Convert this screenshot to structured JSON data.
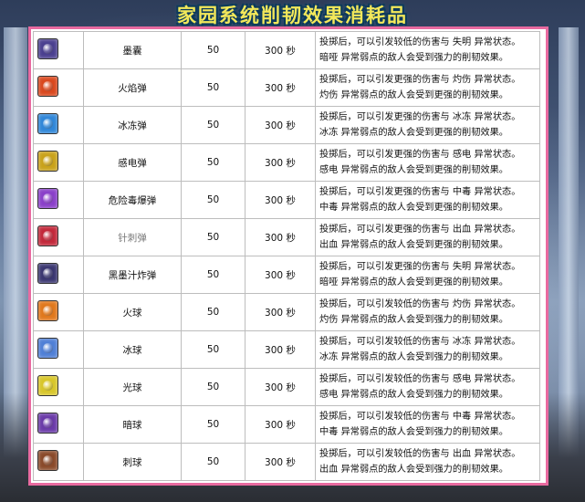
{
  "header": {
    "title": "家园系统削韧效果消耗品"
  },
  "rows": [
    {
      "name": "墨囊",
      "qty": "50",
      "time": "300 秒",
      "line1": "投掷后，可以引发较低的伤害与 失明 异常状态。",
      "line2": "暗哑 异常弱点的敌人会受到强力的削韧效果。",
      "icon": "bomb-dark-icon",
      "color": "#4a3f8f"
    },
    {
      "name": "火焰弹",
      "qty": "50",
      "time": "300 秒",
      "line1": "投掷后，可以引发更强的伤害与 灼伤 异常状态。",
      "line2": "灼伤 异常弱点的敌人会受到更强的削韧效果。",
      "icon": "bomb-fire-icon",
      "color": "#d9481e"
    },
    {
      "name": "冰冻弹",
      "qty": "50",
      "time": "300 秒",
      "line1": "投掷后，可以引发更强的伤害与 冰冻 异常状态。",
      "line2": "冰冻 异常弱点的敌人会受到更强的削韧效果。",
      "icon": "bomb-ice-icon",
      "color": "#2f86d8"
    },
    {
      "name": "感电弹",
      "qty": "50",
      "time": "300 秒",
      "line1": "投掷后，可以引发更强的伤害与 感电 异常状态。",
      "line2": "感电 异常弱点的敌人会受到更强的削韧效果。",
      "icon": "bomb-lightning-icon",
      "color": "#c9a21a"
    },
    {
      "name": "危险毒爆弹",
      "qty": "50",
      "time": "300 秒",
      "line1": "投掷后，可以引发更强的伤害与 中毒 异常状态。",
      "line2": "中毒 异常弱点的敌人会受到更强的削韧效果。",
      "icon": "bomb-poison-icon",
      "color": "#8a3fc9"
    },
    {
      "name": "针刺弹",
      "qty": "50",
      "time": "300 秒",
      "line1": "投掷后，可以引发更强的伤害与 出血 异常状态。",
      "line2": "出血 异常弱点的敌人会受到更强的削韧效果。",
      "icon": "bomb-needle-icon",
      "color": "#c2283a"
    },
    {
      "name": "黑墨汁炸弹",
      "qty": "50",
      "time": "300 秒",
      "line1": "投掷后，可以引发更强的伤害与 失明 异常状态。",
      "line2": "暗哑 异常弱点的敌人会受到更强的削韧效果。",
      "icon": "bomb-ink-icon",
      "color": "#3a3670"
    },
    {
      "name": "火球",
      "qty": "50",
      "time": "300 秒",
      "line1": "投掷后，可以引发较低的伤害与 灼伤 异常状态。",
      "line2": "灼伤 异常弱点的敌人会受到强力的削韧效果。",
      "icon": "fireball-icon",
      "color": "#e0781c"
    },
    {
      "name": "冰球",
      "qty": "50",
      "time": "300 秒",
      "line1": "投掷后，可以引发较低的伤害与 冰冻 异常状态。",
      "line2": "冰冻 异常弱点的敌人会受到强力的削韧效果。",
      "icon": "iceball-icon",
      "color": "#4f7fd6"
    },
    {
      "name": "光球",
      "qty": "50",
      "time": "300 秒",
      "line1": "投掷后，可以引发较低的伤害与 感电 异常状态。",
      "line2": "感电 异常弱点的敌人会受到强力的削韧效果。",
      "icon": "lightball-icon",
      "color": "#d8c62a"
    },
    {
      "name": "暗球",
      "qty": "50",
      "time": "300 秒",
      "line1": "投掷后，可以引发较低的伤害与 中毒 异常状态。",
      "line2": "中毒 异常弱点的敌人会受到强力的削韧效果。",
      "icon": "darkball-icon",
      "color": "#6a3aa8"
    },
    {
      "name": "刺球",
      "qty": "50",
      "time": "300 秒",
      "line1": "投掷后，可以引发较低的伤害与 出血 异常状态。",
      "line2": "出血 异常弱点的敌人会受到强力的削韧效果。",
      "icon": "spikeball-icon",
      "color": "#8a4a2a"
    }
  ]
}
